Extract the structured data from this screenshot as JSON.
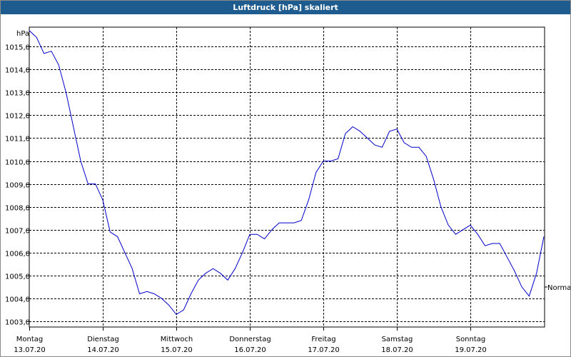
{
  "window": {
    "title": "Luftdruck [hPa] skaliert"
  },
  "chart_data": {
    "type": "line",
    "title": "Luftdruck [hPa] skaliert",
    "ylabel": "hPa",
    "ylim": [
      1002.75,
      1015.85
    ],
    "yticks": [
      "1003,0",
      "1004,0",
      "1005,0",
      "1006,0",
      "1007,0",
      "1008,0",
      "1009,0",
      "1010,0",
      "1011,0",
      "1012,0",
      "1013,0",
      "1014,0",
      "1015,0"
    ],
    "x_labels": [
      {
        "day": "Montag",
        "date": "13.07.20"
      },
      {
        "day": "Dienstag",
        "date": "14.07.20"
      },
      {
        "day": "Mittwoch",
        "date": "15.07.20"
      },
      {
        "day": "Donnerstag",
        "date": "16.07.20"
      },
      {
        "day": "Freitag",
        "date": "17.07.20"
      },
      {
        "day": "Samstag",
        "date": "18.07.20"
      },
      {
        "day": "Sonntag",
        "date": "19.07.20"
      }
    ],
    "grid": true,
    "reference_label": "Normal",
    "series": [
      {
        "color": "#0000cc",
        "x": [
          0.0,
          0.05,
          0.1,
          0.2,
          0.3,
          0.4,
          0.5,
          0.6,
          0.7,
          0.8,
          0.9,
          1.0,
          1.1,
          1.2,
          1.3,
          1.4,
          1.5,
          1.6,
          1.7,
          1.8,
          1.9,
          2.0,
          2.1,
          2.2,
          2.3,
          2.4,
          2.5,
          2.6,
          2.7,
          2.8,
          2.9,
          3.0,
          3.1,
          3.2,
          3.3,
          3.4,
          3.5,
          3.6,
          3.7,
          3.8,
          3.9,
          4.0,
          4.1,
          4.2,
          4.3,
          4.4,
          4.5,
          4.6,
          4.7,
          4.8,
          4.9,
          5.0,
          5.1,
          5.2,
          5.3,
          5.4,
          5.5,
          5.6,
          5.7,
          5.8,
          5.9,
          6.0,
          6.1,
          6.2,
          6.3,
          6.4,
          6.5,
          6.6,
          6.7,
          6.8,
          6.9,
          7.0
        ],
        "y": [
          1015.7,
          1015.55,
          1015.4,
          1014.7,
          1014.8,
          1014.2,
          1013.0,
          1011.5,
          1010.0,
          1009.0,
          1009.0,
          1008.3,
          1006.9,
          1006.7,
          1006.0,
          1005.3,
          1004.2,
          1004.3,
          1004.2,
          1004.0,
          1003.7,
          1003.3,
          1003.5,
          1004.2,
          1004.8,
          1005.1,
          1005.3,
          1005.1,
          1004.8,
          1005.3,
          1006.0,
          1006.8,
          1006.8,
          1006.6,
          1007.0,
          1007.3,
          1007.3,
          1007.3,
          1007.4,
          1008.3,
          1009.5,
          1010.0,
          1010.0,
          1010.1,
          1011.2,
          1011.5,
          1011.3,
          1011.0,
          1010.7,
          1010.6,
          1011.3,
          1011.4,
          1010.8,
          1010.6,
          1010.6,
          1010.2,
          1009.2,
          1008.0,
          1007.2,
          1006.8,
          1007.0,
          1007.2,
          1006.8,
          1006.3,
          1006.4,
          1006.4,
          1005.8,
          1005.2,
          1004.5,
          1004.1,
          1005.1,
          1006.7
        ]
      }
    ]
  }
}
